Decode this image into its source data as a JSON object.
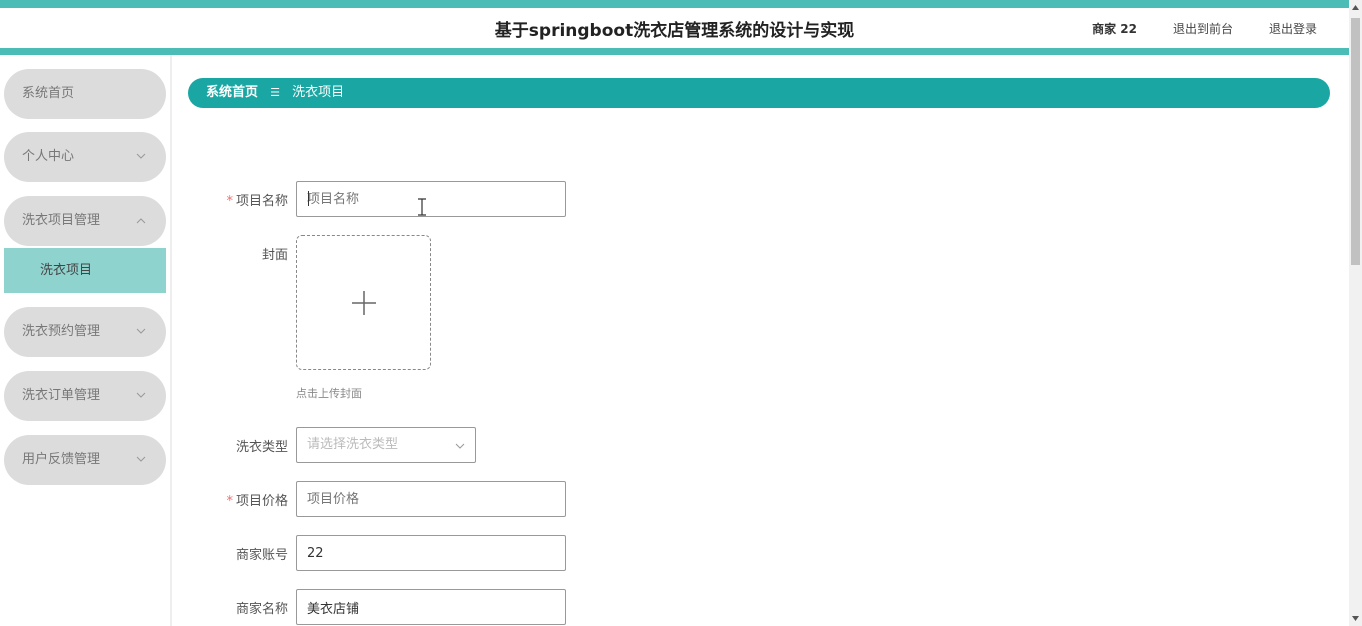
{
  "header": {
    "title": "基于springboot洗衣店管理系统的设计与实现",
    "user": "商家 22",
    "to_front": "退出到前台",
    "logout": "退出登录"
  },
  "sidebar": {
    "items": [
      {
        "label": "系统首页"
      },
      {
        "label": "个人中心"
      },
      {
        "label": "洗衣项目管理"
      },
      {
        "label": "洗衣预约管理"
      },
      {
        "label": "洗衣订单管理"
      },
      {
        "label": "用户反馈管理"
      }
    ],
    "active_sub": "洗衣项目"
  },
  "breadcrumb": {
    "home": "系统首页",
    "separator": "☰",
    "current": "洗衣项目"
  },
  "form": {
    "name_label": "项目名称",
    "name_placeholder": "项目名称",
    "cover_label": "封面",
    "cover_tip": "点击上传封面",
    "type_label": "洗衣类型",
    "type_placeholder": "请选择洗衣类型",
    "price_label": "项目价格",
    "price_placeholder": "项目价格",
    "account_label": "商家账号",
    "account_value": "22",
    "shop_label": "商家名称",
    "shop_value": "美衣店铺",
    "required_mark": "*"
  },
  "colors": {
    "accent": "#1aa7a3",
    "stripe": "#4bbcb6",
    "active_sub_bg": "#8fd3cf",
    "menu_bg": "#dcdcdc",
    "required": "#f56c6c"
  }
}
